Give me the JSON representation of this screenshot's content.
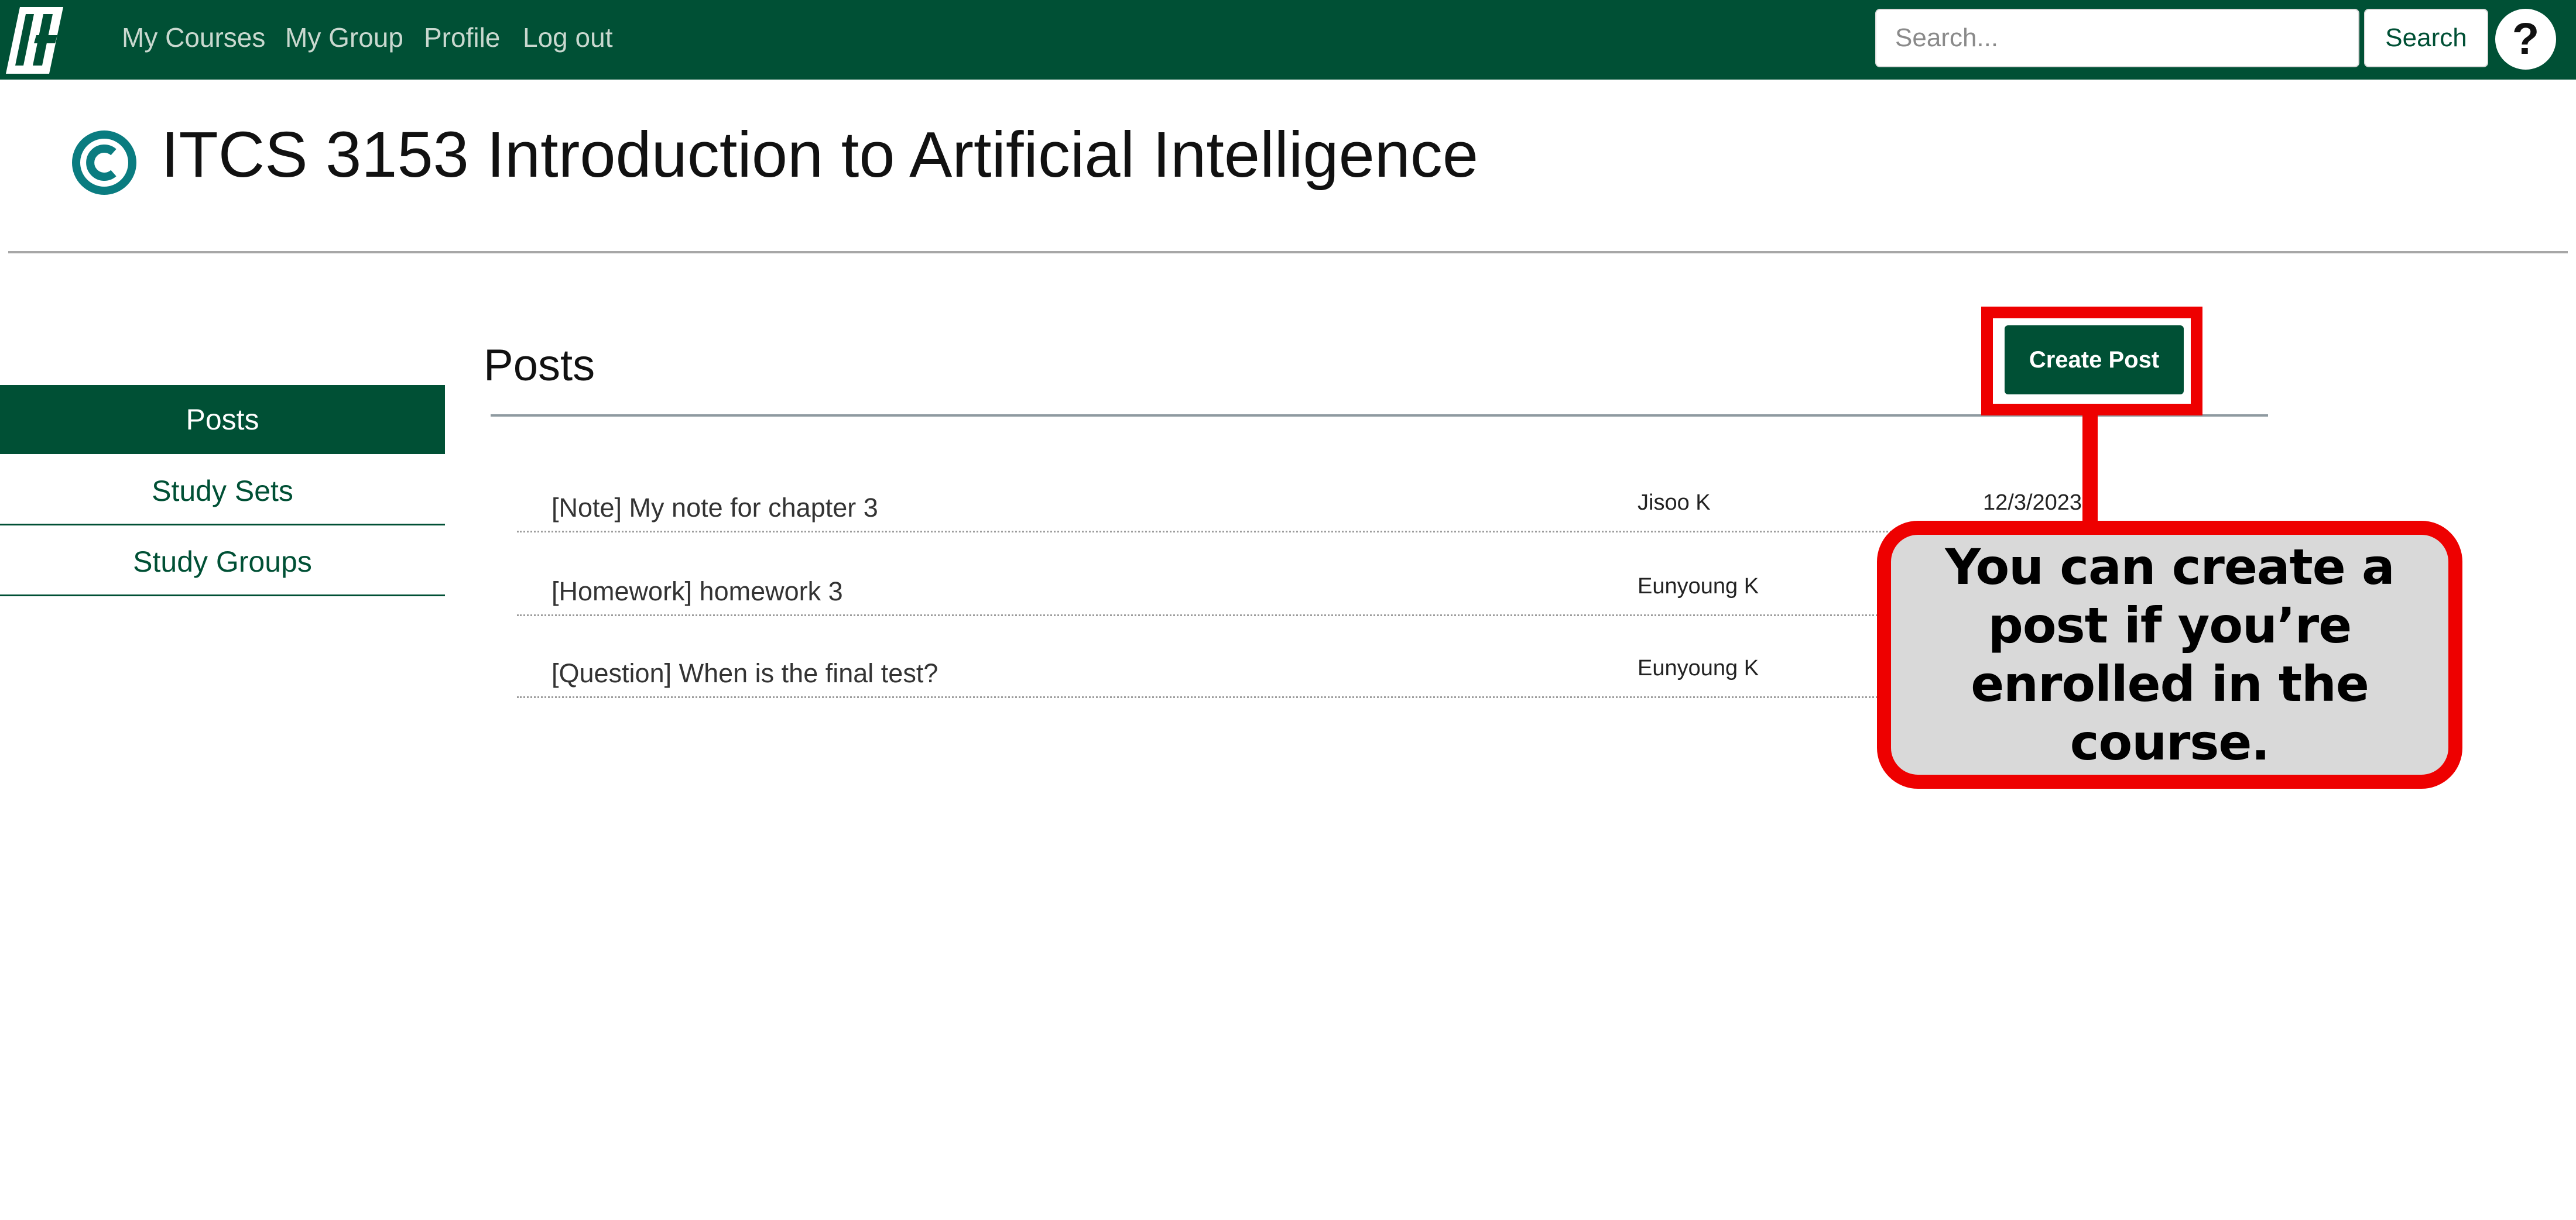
{
  "colors": {
    "brand_green": "#005035",
    "nav_text": "#c9d8cf",
    "annotation_red": "#ee0000",
    "callout_fill": "#d9d9d9",
    "accent_teal": "#0a7c80"
  },
  "nav": {
    "logo_icon": "university-logo-icon",
    "links": [
      "My Courses",
      "My Group",
      "Profile",
      "Log out"
    ],
    "search": {
      "placeholder": "Search...",
      "value": ""
    },
    "search_label": "Search",
    "help_label": "?"
  },
  "course": {
    "icon": "copyright-c-icon",
    "title": "ITCS 3153 Introduction to Artificial Intelligence"
  },
  "sidebar": {
    "items": [
      {
        "label": "Posts",
        "active": true
      },
      {
        "label": "Study Sets",
        "active": false
      },
      {
        "label": "Study Groups",
        "active": false
      }
    ]
  },
  "posts": {
    "heading": "Posts",
    "create_label": "Create Post",
    "rows": [
      {
        "title": "[Note] My note for chapter 3",
        "author": "Jisoo K",
        "date": "12/3/2023"
      },
      {
        "title": "[Homework] homework 3",
        "author": "Eunyoung K",
        "date": ""
      },
      {
        "title": "[Question] When is the final test?",
        "author": "Eunyoung K",
        "date": ""
      }
    ]
  },
  "annotation": {
    "text": "You can create a post if you’re enrolled in the course."
  }
}
